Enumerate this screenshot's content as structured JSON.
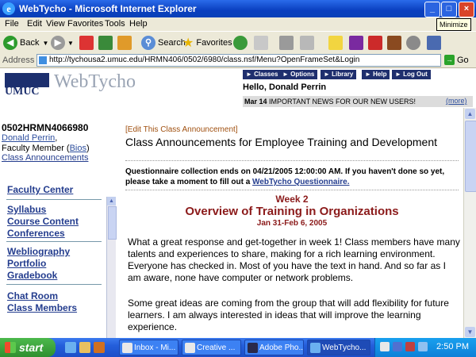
{
  "window": {
    "title": "WebTycho - Microsoft Internet Explorer",
    "tooltip": "Minimize"
  },
  "menu": [
    "File",
    "Edit",
    "View",
    "Favorites",
    "Tools",
    "Help"
  ],
  "toolbar": {
    "back_label": "Back",
    "search_label": "Search",
    "favorites_label": "Favorites"
  },
  "address": {
    "label": "Address",
    "url": "http://tychousa2.umuc.edu/HRMN406/0502/6980/class.nsf/Menu?OpenFrameSet&Login",
    "go_label": "Go"
  },
  "header": {
    "logo_text": "UMUC",
    "brand": "WebTycho",
    "nav_buttons": [
      "Classes",
      "Options",
      "Library",
      "Help",
      "Log Out"
    ],
    "greeting": "Hello, Donald Perrin",
    "news_date": "Mar 14",
    "news_text": "IMPORTANT NEWS FOR OUR NEW USERS!",
    "more_label": "(more)"
  },
  "sidebar": {
    "course_id": "0502HRMN4066980",
    "user_name": "Donald Perrin",
    "user_comma": ",",
    "role_prefix": "Faculty Member (",
    "bios_label": "Bios",
    "role_suffix": ")",
    "current_page": "Class Announcements",
    "links": [
      "Faculty Center",
      "Syllabus",
      "Course Content",
      "Conferences",
      "Webliography",
      "Portfolio",
      "Gradebook",
      "Chat Room",
      "Class Members"
    ]
  },
  "main": {
    "edit_link": "[Edit This Class Announcement]",
    "title": "Class Announcements for Employee Training and Development",
    "questionnaire_text": "Questionnaire collection ends on 04/21/2005 12:00:00 AM. If you haven't done so yet, please take a moment to fill out a",
    "questionnaire_link": "WebTycho Questionnaire.",
    "week": "Week 2",
    "heading": "Overview of Training in Organizations",
    "dates": "Jan 31-Feb 6, 2005",
    "para1": "What a great response and get-together in week 1! Class members have many talents and experiences to share, making for a rich learning environment. Everyone has checked in. Most of you have the text in hand. And so far as I am aware, none have computer or network problems.",
    "para2": "Some great ideas are coming from the group that will add flexibility for future learners. I am always interested in ideas that will improve the learning experience."
  },
  "taskbar": {
    "start_label": "start",
    "tasks": [
      "Inbox - Mi...",
      "Creative ...",
      "Adobe Pho...",
      "WebTycho..."
    ],
    "clock": "2:50 PM"
  }
}
